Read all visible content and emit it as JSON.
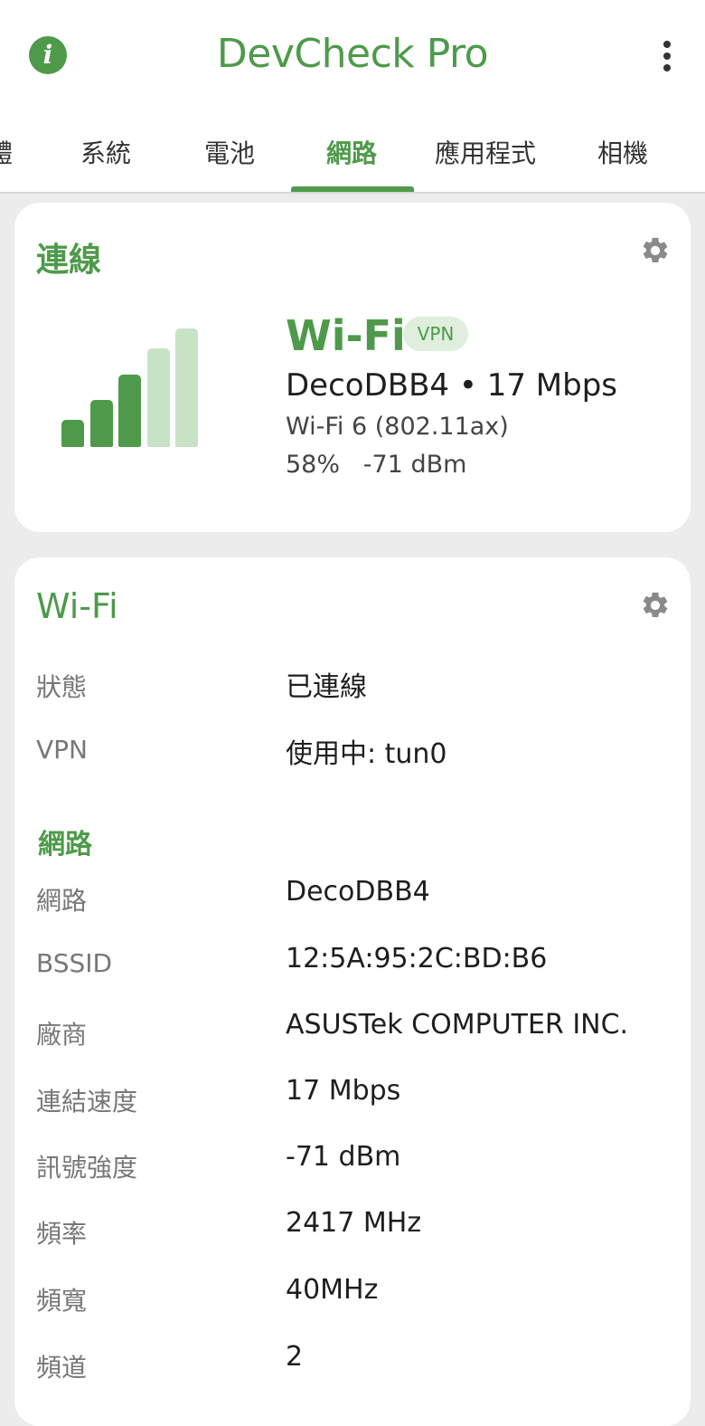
{
  "header": {
    "title": "DevCheck Pro",
    "info_icon": "info-icon",
    "menu_icon": "more-vert-icon",
    "accent_color": "#4e9a4a"
  },
  "tabs": [
    {
      "label": "體",
      "active": false
    },
    {
      "label": "系統",
      "active": false
    },
    {
      "label": "電池",
      "active": false
    },
    {
      "label": "網路",
      "active": true
    },
    {
      "label": "應用程式",
      "active": false
    },
    {
      "label": "相機",
      "active": false
    }
  ],
  "connection": {
    "title": "連線",
    "type": "Wi-Fi",
    "badge": "VPN",
    "ssid_speed": "DecoDBB4 • 17 Mbps",
    "standard": "Wi-Fi 6 (802.11ax)",
    "signal_line": "58%   -71 dBm",
    "signal_bars_total": 5,
    "signal_bars_active": 3
  },
  "wifi": {
    "title": "Wi-Fi",
    "rows": [
      {
        "label": "狀態",
        "value": "已連線"
      },
      {
        "label": "VPN",
        "value": "使用中: tun0"
      }
    ],
    "network_section": "網路",
    "network_rows": [
      {
        "label": "網路",
        "value": "DecoDBB4"
      },
      {
        "label": "BSSID",
        "value": "12:5A:95:2C:BD:B6"
      },
      {
        "label": "廠商",
        "value": "ASUSTek COMPUTER INC."
      },
      {
        "label": "連結速度",
        "value": "17 Mbps"
      },
      {
        "label": "訊號強度",
        "value": "-71 dBm"
      },
      {
        "label": "頻率",
        "value": "2417 MHz"
      },
      {
        "label": "頻寬",
        "value": "40MHz"
      },
      {
        "label": "頻道",
        "value": "2"
      }
    ]
  }
}
